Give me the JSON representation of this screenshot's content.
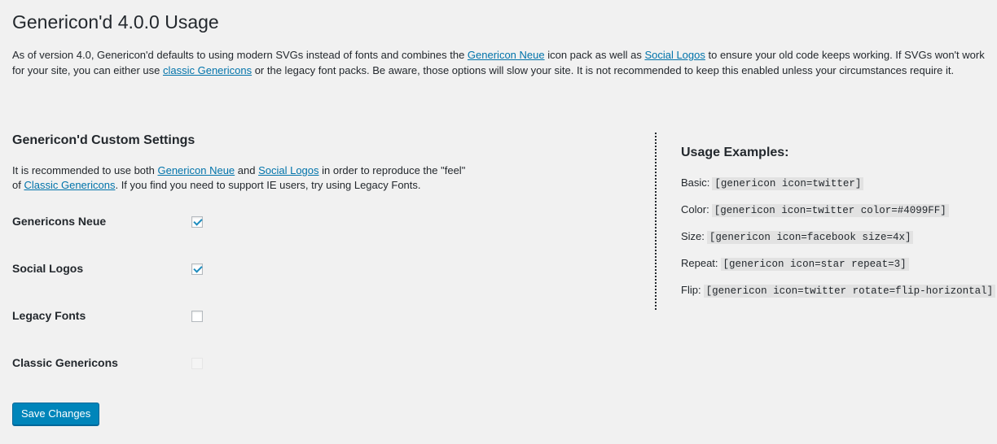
{
  "page": {
    "title": "Genericon'd 4.0.0 Usage"
  },
  "intro": {
    "part1": "As of version 4.0, Genericon'd defaults to using modern SVGs instead of fonts and combines the ",
    "link1": "Genericon Neue",
    "part2": " icon pack as well as ",
    "link2": "Social Logos",
    "part3": " to ensure your old code keeps working. If SVGs won't work for your site, you can either use ",
    "link3": "classic Genericons",
    "part4": " or the legacy font packs. Be aware, those options will slow your site. It is not recommended to keep this enabled unless your circumstances require it."
  },
  "settings": {
    "heading": "Genericon'd Custom Settings",
    "desc_part1": "It is recommended to use both ",
    "desc_link1": "Genericon Neue",
    "desc_part2": " and ",
    "desc_link2": "Social Logos",
    "desc_part3": " in order to reproduce the \"feel\"",
    "desc_part4": "of ",
    "desc_link3": "Classic Genericons",
    "desc_part5": ". If you find you need to support IE users, try using Legacy Fonts.",
    "options": [
      {
        "label": "Genericons Neue",
        "checked": true,
        "disabled": false
      },
      {
        "label": "Social Logos",
        "checked": true,
        "disabled": false
      },
      {
        "label": "Legacy Fonts",
        "checked": false,
        "disabled": false
      },
      {
        "label": "Classic Genericons",
        "checked": false,
        "disabled": true
      }
    ],
    "save_label": "Save Changes"
  },
  "examples": {
    "heading": "Usage Examples:",
    "items": [
      {
        "label": "Basic:",
        "code": "[genericon icon=twitter]"
      },
      {
        "label": "Color:",
        "code": "[genericon icon=twitter color=#4099FF]"
      },
      {
        "label": "Size:",
        "code": "[genericon icon=facebook size=4x]"
      },
      {
        "label": "Repeat:",
        "code": "[genericon icon=star repeat=3]"
      },
      {
        "label": "Flip:",
        "code": "[genericon icon=twitter rotate=flip-horizontal]"
      }
    ]
  },
  "colors": {
    "link": "#0073aa",
    "button": "#0085ba",
    "check": "#1e8cbe"
  }
}
